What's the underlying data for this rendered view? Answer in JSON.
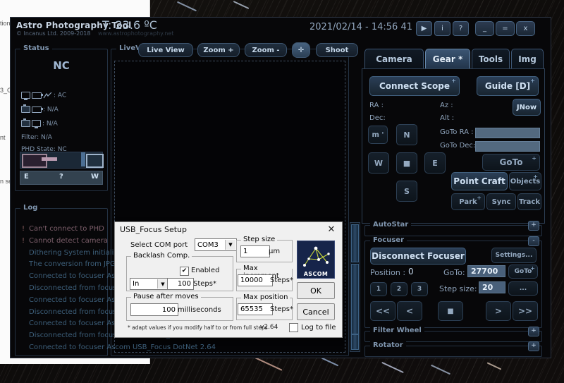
{
  "app": {
    "title": "Astro Photography Tool",
    "temperature": "T: 23.6 ºC",
    "copyright": "© Incanus Ltd. 2009-2018",
    "url": "www.astrophotography.net",
    "datetime": "2021/02/14 - 14:56 41",
    "titlebar_buttons": [
      {
        "name": "play-button",
        "glyph": "▶"
      },
      {
        "name": "info-button",
        "glyph": "i"
      },
      {
        "name": "help-button",
        "glyph": "?"
      },
      {
        "name": "minimize-button",
        "glyph": "_"
      },
      {
        "name": "maximize-button",
        "glyph": "="
      },
      {
        "name": "close-button",
        "glyph": "x"
      }
    ]
  },
  "status": {
    "label": "Status",
    "state": "NC",
    "power": ": AC",
    "camera": ": N/A",
    "card": ": N/A",
    "filter": "Filter: N/A",
    "phd": "PHD State: NC",
    "meridian": {
      "east": "E",
      "unknown": "?",
      "west": "W"
    }
  },
  "liveview": {
    "label": "LiveView",
    "buttons": [
      {
        "name": "live-view-button",
        "label": "Live View"
      },
      {
        "name": "zoom-in-button",
        "label": "Zoom +"
      },
      {
        "name": "zoom-out-button",
        "label": "Zoom -"
      },
      {
        "name": "crosshair-button",
        "label": "✛"
      },
      {
        "name": "shoot-button",
        "label": "Shoot"
      }
    ]
  },
  "log": {
    "label": "Log",
    "lines": [
      {
        "mark": "!",
        "text": "Can't connect to PHD",
        "level": "error"
      },
      {
        "mark": "!",
        "text": "Cannot detect camera",
        "level": "error"
      },
      {
        "mark": "",
        "text": "Dithering System initialized",
        "level": "info"
      },
      {
        "mark": "",
        "text": "The conversion from JPG",
        "level": "info"
      },
      {
        "mark": "",
        "text": "Connected to focuser Ascom USB_Focus DotNet 2.64",
        "level": "info"
      },
      {
        "mark": "",
        "text": "Disconnected from focuser Ascom USB_Focus DotNet 2.64",
        "level": "info"
      },
      {
        "mark": "",
        "text": "Connected to focuser Ascom USB_Focus DotNet 2.64",
        "level": "info"
      },
      {
        "mark": "",
        "text": "Disconnected from focuser Ascom USB_Focus DotNet 2.64",
        "level": "info"
      },
      {
        "mark": "",
        "text": "Connected to focuser Ascom USB_Focus DotNet 2.64",
        "level": "info"
      },
      {
        "mark": "",
        "text": "Disconnected from focuser Ascom USB_Focus DotNet 2.64",
        "level": "info"
      },
      {
        "mark": "",
        "text": "Connected to focuser Ascom USB_Focus DotNet 2.64",
        "level": "info"
      }
    ]
  },
  "tabs": [
    {
      "name": "tab-camera",
      "label": "Camera",
      "active": false
    },
    {
      "name": "tab-gear",
      "label": "Gear *",
      "active": true
    },
    {
      "name": "tab-tools",
      "label": "Tools",
      "active": false
    },
    {
      "name": "tab-img",
      "label": "Img",
      "active": false
    }
  ],
  "gear": {
    "connect_scope": "Connect Scope",
    "guide": "Guide [D]",
    "ra_label": "RA :",
    "dec_label": "Dec:",
    "az_label": "Az :",
    "alt_label": "Alt :",
    "goto_ra_label": "GoTo RA :",
    "goto_dec_label": "GoTo Dec:",
    "jnow": "JNow",
    "direction": {
      "n": "N",
      "s": "S",
      "e": "E",
      "w": "W",
      "stop": "■",
      "rate": "m '"
    },
    "goto_button": "GoTo",
    "point_craft": "Point Craft",
    "objects": "Objects",
    "park": "Park",
    "sync": "Sync",
    "track": "Track"
  },
  "autostar": {
    "label": "AutoStar"
  },
  "focuser": {
    "label": "Focuser",
    "disconnect": "Disconnect Focuser",
    "settings": "Settings...",
    "position_label": "Position :",
    "position_value": "0",
    "presets": [
      "1",
      "2",
      "3"
    ],
    "goto_label": "GoTo:",
    "goto_value": "27700",
    "goto_button": "GoTo",
    "stepsize_label": "Step size:",
    "stepsize_value": "20",
    "more_button": "...",
    "move_buttons": [
      "<<",
      "<",
      "■",
      ">",
      ">>"
    ]
  },
  "filter_wheel": {
    "label": "Filter Wheel"
  },
  "rotator": {
    "label": "Rotator"
  },
  "dialog": {
    "title": "USB_Focus Setup",
    "close_glyph": "✕",
    "com_label": "Select COM port",
    "com_value": "COM3",
    "backlash": {
      "label": "Backlash Comp.",
      "enabled_label": "Enabled",
      "enabled_checked": "✔",
      "direction": "In",
      "steps_value": "100",
      "steps_label": "Steps*"
    },
    "pause": {
      "label": "Pause after moves",
      "value": "100",
      "units": "milliseconds"
    },
    "step_size": {
      "label": "Step size",
      "value": "1",
      "units": "µm"
    },
    "max_increment": {
      "label": "Max increment",
      "value": "10000",
      "units": "Steps*"
    },
    "max_position": {
      "label": "Max position",
      "value": "65535",
      "units": "Steps*"
    },
    "ascom_logo_text": "ASCOM",
    "ok": "OK",
    "cancel": "Cancel",
    "note": "* adapt values if you modify  half to or from full steps",
    "version": "v2.64",
    "log_to_file": "Log to file"
  },
  "background_window": {
    "lines": [
      "tion",
      "3_C",
      "nt",
      "n se"
    ]
  },
  "colors": {
    "panel_bg": "#070709",
    "accent": "#4a6688",
    "text": "#8fa3bd",
    "error": "#8a6f7a",
    "field": "#49607a"
  }
}
